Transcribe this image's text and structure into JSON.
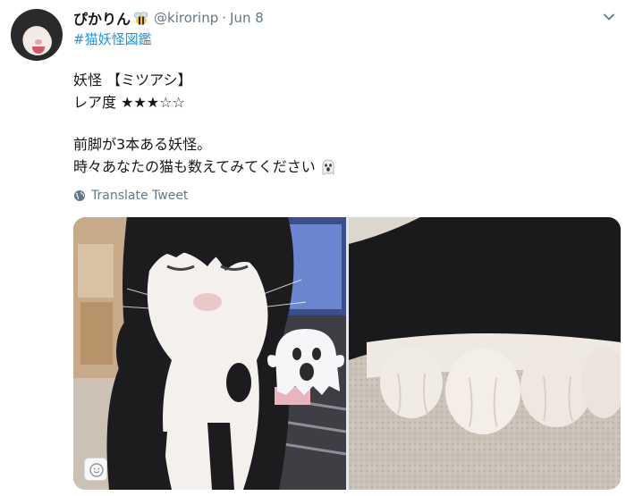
{
  "tweet": {
    "display_name": "ぴかりん",
    "handle": "@kirorinp",
    "separator": "·",
    "date": "Jun 8",
    "hashtag": "#猫妖怪図鑑",
    "lines": [
      "妖怪 【ミツアシ】",
      "レア度 ★★★☆☆",
      "前脚が3本ある妖怪。",
      "時々あなたの猫も数えてみてください"
    ],
    "translate_label": "Translate Tweet"
  },
  "icons": {
    "avatar": "avatar",
    "name_emoji": "bee-icon",
    "more": "chevron-down-icon",
    "line_emoji": "ghost-icon",
    "translate": "globe-icon",
    "sticker": "smiley-sticker-icon"
  },
  "colors": {
    "link": "#1b95e0",
    "secondary_text": "#657786",
    "primary_text": "#14171a"
  }
}
